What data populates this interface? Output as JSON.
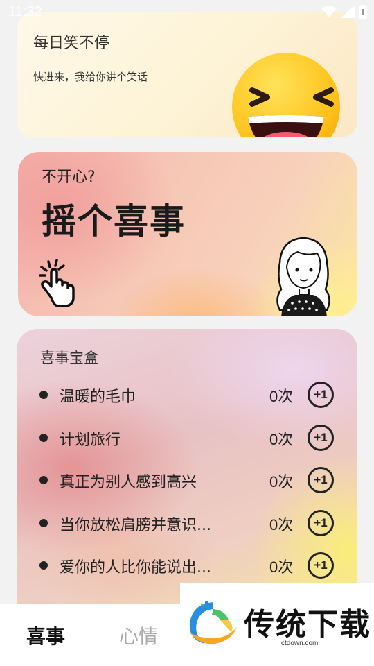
{
  "status_bar": {
    "time": "11:32",
    "icons": [
      "wifi-icon",
      "signal-icon",
      "battery-icon"
    ]
  },
  "laugh_card": {
    "title": "每日笑不停",
    "subtitle": "快进来，我给你讲个笑话",
    "icon": "laughing-emoji-icon"
  },
  "shake_card": {
    "question": "不开心?",
    "headline": "摇个喜事",
    "icons": [
      "tap-hand-icon",
      "girl-illustration"
    ]
  },
  "box_card": {
    "title": "喜事宝盒",
    "items": [
      {
        "label": "温暖的毛巾",
        "count": "0次",
        "button": "+1"
      },
      {
        "label": "计划旅行",
        "count": "0次",
        "button": "+1"
      },
      {
        "label": "真正为别人感到高兴",
        "count": "0次",
        "button": "+1"
      },
      {
        "label": "当你放松肩膀并意识...",
        "count": "0次",
        "button": "+1"
      },
      {
        "label": "爱你的人比你能说出...",
        "count": "0次",
        "button": "+1"
      }
    ]
  },
  "bottom_nav": {
    "tabs": [
      {
        "label": "喜事",
        "active": true
      },
      {
        "label": "心情",
        "active": false
      }
    ]
  },
  "watermark": {
    "brand": "传统下载",
    "url": "ctdown.com"
  }
}
